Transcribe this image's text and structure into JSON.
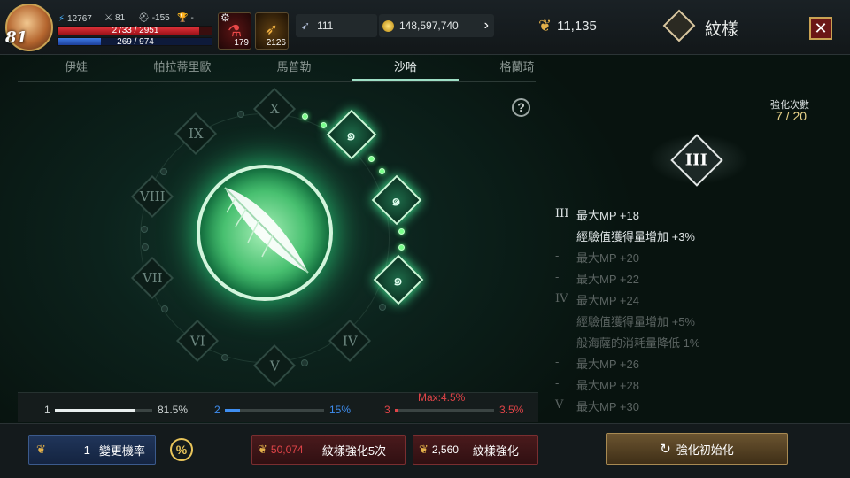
{
  "player": {
    "level": "81",
    "power": "12767",
    "attack": "81",
    "defense": "-155",
    "trophy": "-",
    "hp": "2733 / 2951",
    "mp": "269 / 974"
  },
  "items": [
    {
      "name": "potion-icon",
      "count": "179"
    },
    {
      "name": "horn-icon",
      "count": "2126"
    }
  ],
  "currency": {
    "feather": "111",
    "gold": "148,597,740",
    "crest": "11,135"
  },
  "title": "紋樣",
  "tabs": [
    "伊娃",
    "帕拉蒂里歐",
    "馬普勒",
    "沙哈",
    "格蘭琦"
  ],
  "active_tab": "沙哈",
  "circle_nodes": [
    "X",
    "IX",
    "VIII",
    "VII",
    "VI",
    "V",
    "IV"
  ],
  "enhance": {
    "label": "強化次數",
    "value": "7 / 20",
    "tier": "III"
  },
  "rules": [
    {
      "tier": "III",
      "text": "最大MP +18",
      "active": true
    },
    {
      "tier": "",
      "text": "經驗值獲得量增加 +3%",
      "active": true
    },
    {
      "tier": "-",
      "text": "最大MP +20",
      "active": false
    },
    {
      "tier": "-",
      "text": "最大MP +22",
      "active": false
    },
    {
      "tier": "IV",
      "text": "最大MP +24",
      "active": false
    },
    {
      "tier": "",
      "text": "經驗值獲得量增加 +5%",
      "active": false
    },
    {
      "tier": "",
      "text": "般海薩的消耗量降低 1%",
      "active": false
    },
    {
      "tier": "-",
      "text": "最大MP +26",
      "active": false
    },
    {
      "tier": "-",
      "text": "最大MP +28",
      "active": false
    },
    {
      "tier": "V",
      "text": "最大MP +30",
      "active": false
    }
  ],
  "rates": [
    {
      "index": "1",
      "value": "81.5%",
      "fill": 0.815,
      "color": "#e8eeee"
    },
    {
      "index": "2",
      "value": "15%",
      "fill": 0.15,
      "color": "#3f8ef0"
    },
    {
      "index": "3",
      "value": "3.5%",
      "fill": 0.035,
      "color": "#e04448",
      "max": "Max:4.5%"
    }
  ],
  "buttons": {
    "change_count": "1",
    "change_label": "變更機率",
    "enhance5_cost": "50,074",
    "enhance5_label": "紋樣強化5次",
    "enhance_cost": "2,560",
    "enhance_label": "紋樣強化",
    "reset_label": "強化初始化"
  }
}
